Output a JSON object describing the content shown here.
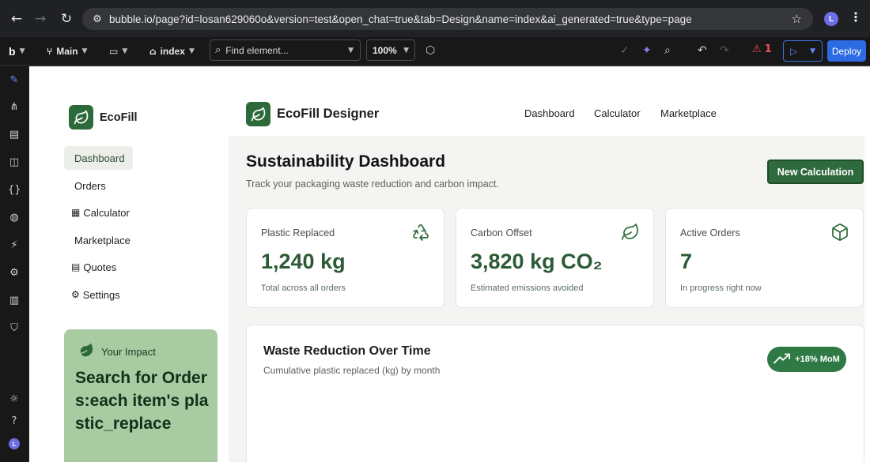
{
  "browser": {
    "url": "bubble.io/page?id=losan629060o&version=test&open_chat=true&tab=Design&name=index&ai_generated=true&type=page",
    "profile_initial": "L"
  },
  "editor_toolbar": {
    "branch_label": "Main",
    "page_label": "index",
    "find_placeholder": "Find element...",
    "zoom_value": "100%",
    "issues_count": "1",
    "deploy_label": "Deploy"
  },
  "rail": {
    "avatar_initial": "L"
  },
  "app": {
    "sidebar": {
      "brand_name": "EcoFill",
      "items": [
        {
          "label": "Dashboard",
          "prefix": ""
        },
        {
          "label": "Orders",
          "prefix": ""
        },
        {
          "label": "Calculator",
          "prefix": "▦"
        },
        {
          "label": "Marketplace",
          "prefix": ""
        },
        {
          "label": "Quotes",
          "prefix": "▤"
        },
        {
          "label": "Settings",
          "prefix": "⚙"
        }
      ],
      "impact": {
        "heading": "Your Impact",
        "body": "Search for Orders:each item's plastic_replace"
      }
    },
    "header": {
      "brand_name": "EcoFill Designer",
      "nav": [
        "Dashboard",
        "Calculator",
        "Marketplace"
      ]
    },
    "main": {
      "title": "Sustainability Dashboard",
      "subtitle": "Track your packaging waste reduction and carbon impact.",
      "primary_button": "New Calculation",
      "stats": [
        {
          "label": "Plastic Replaced",
          "value": "1,240 kg",
          "note": "Total across all orders",
          "icon": "recycle-icon"
        },
        {
          "label": "Carbon Offset",
          "value": "3,820 kg CO₂",
          "note": "Estimated emissions avoided",
          "icon": "leaf-icon"
        },
        {
          "label": "Active Orders",
          "value": "7",
          "note": "In progress right now",
          "icon": "box-icon"
        }
      ],
      "chart_card": {
        "title": "Waste Reduction Over Time",
        "subtitle": "Cumulative plastic replaced (kg) by month",
        "badge": "+18% MoM"
      }
    }
  },
  "colors": {
    "brand_green": "#2d6a3a",
    "impact_card": "#a9cba2",
    "deploy_blue": "#2d6be4"
  }
}
